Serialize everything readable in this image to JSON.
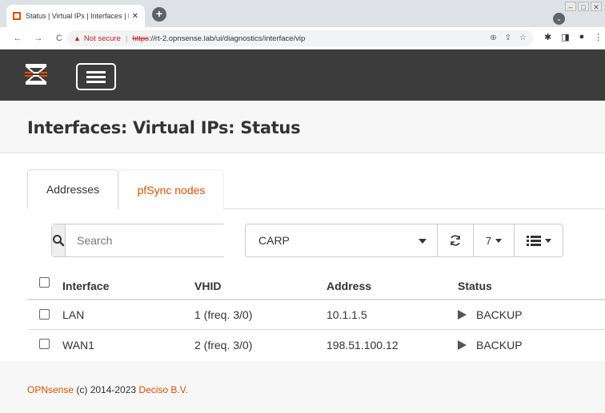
{
  "browser": {
    "tab_title": "Status | Virtual IPs | Interfaces | R",
    "tab_close": "✕",
    "new_tab": "+",
    "not_secure": "Not secure",
    "url_scheme": "https",
    "url_rest": "://rt-2.opnsense.lab/ui/diagnostics/interface/vip",
    "nav_back": "←",
    "nav_forward": "→",
    "nav_reload": "C"
  },
  "page": {
    "title": "Interfaces: Virtual IPs: Status"
  },
  "tabs": [
    {
      "label": "Addresses",
      "active": true
    },
    {
      "label": "pfSync nodes",
      "active": false
    }
  ],
  "toolbar": {
    "search_placeholder": "Search",
    "filter_value": "CARP",
    "rows_per_page": "7"
  },
  "table": {
    "headers": [
      "Interface",
      "VHID",
      "Address",
      "Status"
    ],
    "rows": [
      {
        "interface": "LAN",
        "vhid": "1 (freq. 3/0)",
        "address": "10.1.1.5",
        "status": "BACKUP"
      },
      {
        "interface": "WAN1",
        "vhid": "2 (freq. 3/0)",
        "address": "198.51.100.12",
        "status": "BACKUP"
      }
    ]
  },
  "footer": {
    "brand": "OPNsense",
    "copyright": " (c) 2014-2023 ",
    "company": "Deciso B.V."
  },
  "colors": {
    "accent": "#d94f00",
    "header_bg": "#3c3c3c",
    "page_bg": "#f7f7f7"
  }
}
